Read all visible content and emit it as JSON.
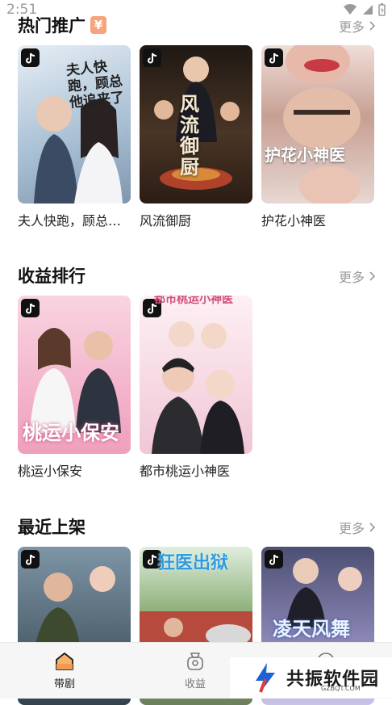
{
  "status": {
    "time": "2:51"
  },
  "sections": [
    {
      "title": "热门推广",
      "badge": "¥",
      "more": "更多",
      "items": [
        {
          "title": "夫人快跑，顾总…",
          "poster_text": "夫人快跑，顾总他追来了",
          "colors": [
            "#dfe8f1",
            "#9fb6cc"
          ]
        },
        {
          "title": "风流御厨",
          "poster_text": "风流御厨",
          "colors": [
            "#2a1f1a",
            "#6b4a2e"
          ]
        },
        {
          "title": "护花小神医",
          "poster_text": "护花小神医",
          "colors": [
            "#e7d2cc",
            "#b9857a"
          ]
        }
      ]
    },
    {
      "title": "收益排行",
      "more": "更多",
      "items": [
        {
          "title": "桃运小保安",
          "poster_text": "桃运小保安",
          "colors": [
            "#f7c9d8",
            "#e98fb0"
          ]
        },
        {
          "title": "都市桃运小神医",
          "poster_text": "都市桃运小神医",
          "colors": [
            "#fbe7ee",
            "#e9b5c8"
          ]
        }
      ]
    },
    {
      "title": "最近上架",
      "more": "更多",
      "items": [
        {
          "title": "",
          "poster_text": "",
          "colors": [
            "#6b7f8f",
            "#2f3c46"
          ]
        },
        {
          "title": "",
          "poster_text": "狂医出狱",
          "colors": [
            "#8fb17c",
            "#c8d6b6"
          ]
        },
        {
          "title": "",
          "poster_text": "凌天风舞",
          "colors": [
            "#5d5f86",
            "#b7b3d8"
          ]
        }
      ]
    }
  ],
  "tabs": [
    {
      "label": "带剧",
      "active": true
    },
    {
      "label": "收益",
      "active": false
    }
  ],
  "watermark": {
    "text": "共振软件园",
    "sub": "GZBQT.COM"
  }
}
